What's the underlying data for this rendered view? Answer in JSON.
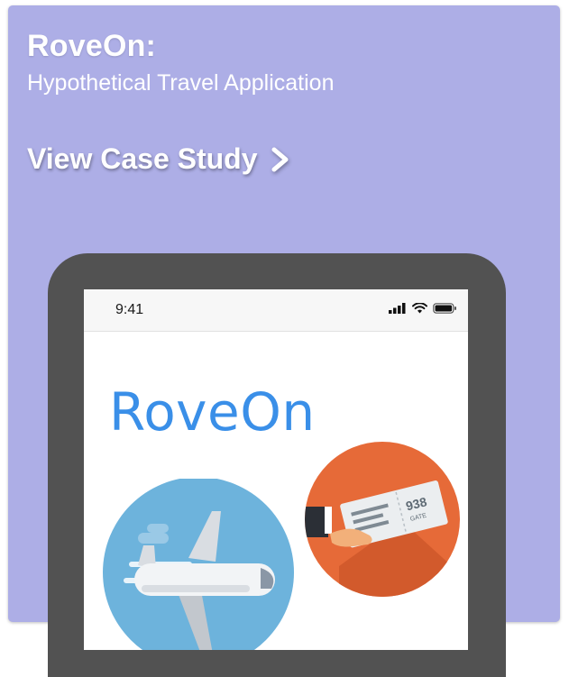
{
  "card": {
    "title": "RoveOn:",
    "subtitle": "Hypothetical Travel Application",
    "cta_label": "View Case Study",
    "cta_icon": "chevron-right-icon"
  },
  "phone": {
    "status_time": "9:41",
    "status_icons": [
      "signal-icon",
      "wifi-icon",
      "battery-icon"
    ],
    "app_name": "RoveOn",
    "ticket_text": "938",
    "ticket_subtext": "GATE"
  },
  "colors": {
    "card_background": "#adaee6",
    "phone_frame": "#525252",
    "app_name": "#3a8fe8",
    "plane_circle": "#6db3dc",
    "ticket_circle": "#e66a38"
  }
}
